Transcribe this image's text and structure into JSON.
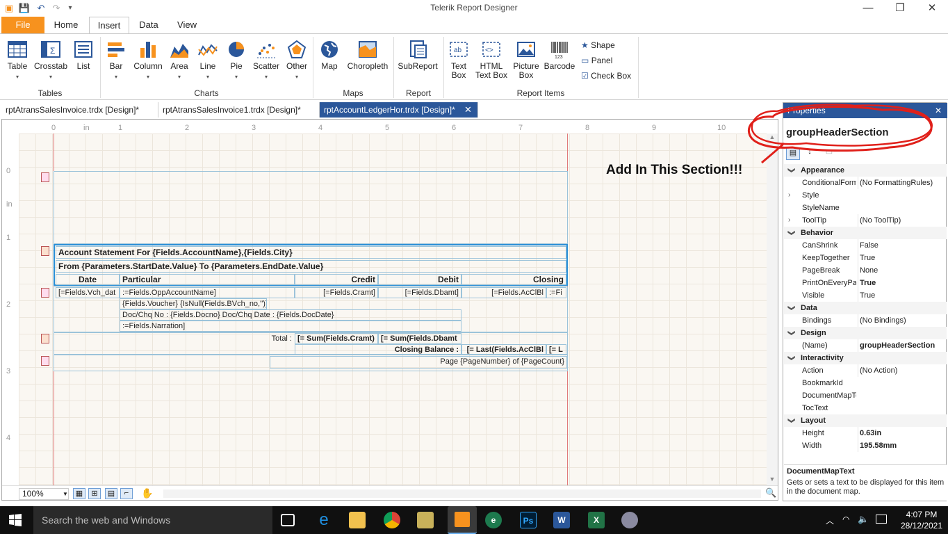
{
  "window": {
    "title": "Telerik Report Designer"
  },
  "ribbon_tabs": {
    "file": "File",
    "home": "Home",
    "insert": "Insert",
    "data": "Data",
    "view": "View"
  },
  "ribbon": {
    "tables": {
      "table": "Table",
      "crosstab": "Crosstab",
      "list": "List",
      "group": "Tables"
    },
    "charts": {
      "bar": "Bar",
      "column": "Column",
      "area": "Area",
      "line": "Line",
      "pie": "Pie",
      "scatter": "Scatter",
      "other": "Other",
      "group": "Charts"
    },
    "maps": {
      "map": "Map",
      "choropleth": "Choropleth",
      "group": "Maps"
    },
    "report": {
      "subreport": "SubReport",
      "group": "Report"
    },
    "items": {
      "textbox1": "Text",
      "textbox2": "Box",
      "html1": "HTML",
      "html2": "Text Box",
      "picture1": "Picture",
      "picture2": "Box",
      "barcode": "Barcode",
      "shape": "Shape",
      "panel": "Panel",
      "checkbox": "Check Box",
      "group": "Report Items"
    }
  },
  "doc_tabs": [
    "rptAtransSalesInvoice.trdx [Design]*",
    "rptAtransSalesInvoice1.trdx [Design]*",
    "rptAccountLedgerHor.trdx [Design]*"
  ],
  "ruler": [
    "0",
    "in",
    "1",
    "2",
    "3",
    "4",
    "5",
    "6",
    "7",
    "8",
    "9",
    "10"
  ],
  "vruler": [
    "0",
    "in",
    "1",
    "2",
    "3",
    "4"
  ],
  "report": {
    "header1": "Account Statement For {Fields.AccountName},{Fields.City}",
    "header2": "From {Parameters.StartDate.Value} To {Parameters.EndDate.Value}",
    "col_date": "Date",
    "col_particular": "Particular",
    "col_credit": "Credit",
    "col_debit": "Debit",
    "col_closing": "Closing",
    "d_date": "[=Fields.Vch_dat",
    "d_particular": ":=Fields.OppAccountName]",
    "d_credit": "[=Fields.Cramt]",
    "d_debit": "[=Fields.Dbamt]",
    "d_closing": "[=Fields.AcClBl",
    "d_closing2": ":=Fi",
    "d_voucher": "{Fields.Voucher} {IsNull(Fields.BVch_no,'')}",
    "d_docno": "Doc/Chq No : {Fields.Docno} Doc/Chq Date : {Fields.DocDate}",
    "d_narration": ":=Fields.Narration]",
    "total_label": "Total :",
    "total_credit": "[= Sum(Fields.Cramt)",
    "total_debit": "[= Sum(Fields.Dbamt",
    "closing_label": "Closing Balance :",
    "closing_val": "[= Last(Fields.AcClBl",
    "closing_val2": "[= L",
    "page": "Page {PageNumber} of {PageCount}"
  },
  "annotation": "Add In This Section!!!",
  "zoom": "100%",
  "properties": {
    "header": "Properties",
    "object": "groupHeaderSection",
    "rows": [
      {
        "cat": true,
        "name": "Appearance"
      },
      {
        "name": "ConditionalFormatting",
        "value": "(No FormattingRules)"
      },
      {
        "name": "Style",
        "value": "",
        "exp": true
      },
      {
        "name": "StyleName",
        "value": ""
      },
      {
        "name": "ToolTip",
        "value": "(No ToolTip)",
        "exp": true
      },
      {
        "cat": true,
        "name": "Behavior"
      },
      {
        "name": "CanShrink",
        "value": "False"
      },
      {
        "name": "KeepTogether",
        "value": "True"
      },
      {
        "name": "PageBreak",
        "value": "None"
      },
      {
        "name": "PrintOnEveryPage",
        "value": "True",
        "bold": true
      },
      {
        "name": "Visible",
        "value": "True"
      },
      {
        "cat": true,
        "name": "Data"
      },
      {
        "name": "Bindings",
        "value": "(No Bindings)"
      },
      {
        "cat": true,
        "name": "Design"
      },
      {
        "name": "(Name)",
        "value": "groupHeaderSection",
        "bold": true
      },
      {
        "cat": true,
        "name": "Interactivity"
      },
      {
        "name": "Action",
        "value": "(No Action)"
      },
      {
        "name": "BookmarkId",
        "value": ""
      },
      {
        "name": "DocumentMapText",
        "value": ""
      },
      {
        "name": "TocText",
        "value": ""
      },
      {
        "cat": true,
        "name": "Layout"
      },
      {
        "name": "Height",
        "value": "0.63in",
        "bold": true
      },
      {
        "name": "Width",
        "value": "195.58mm",
        "bold": true
      }
    ],
    "desc_title": "DocumentMapText",
    "desc_text": "Gets or sets a text to be displayed for this item in the document map."
  },
  "taskbar": {
    "search": "Search the web and Windows",
    "time": "4:07 PM",
    "date": "28/12/2021"
  },
  "colors": {
    "accent": "#2b579a",
    "file_tab": "#f7921e",
    "annotation_red": "#e0201a"
  }
}
